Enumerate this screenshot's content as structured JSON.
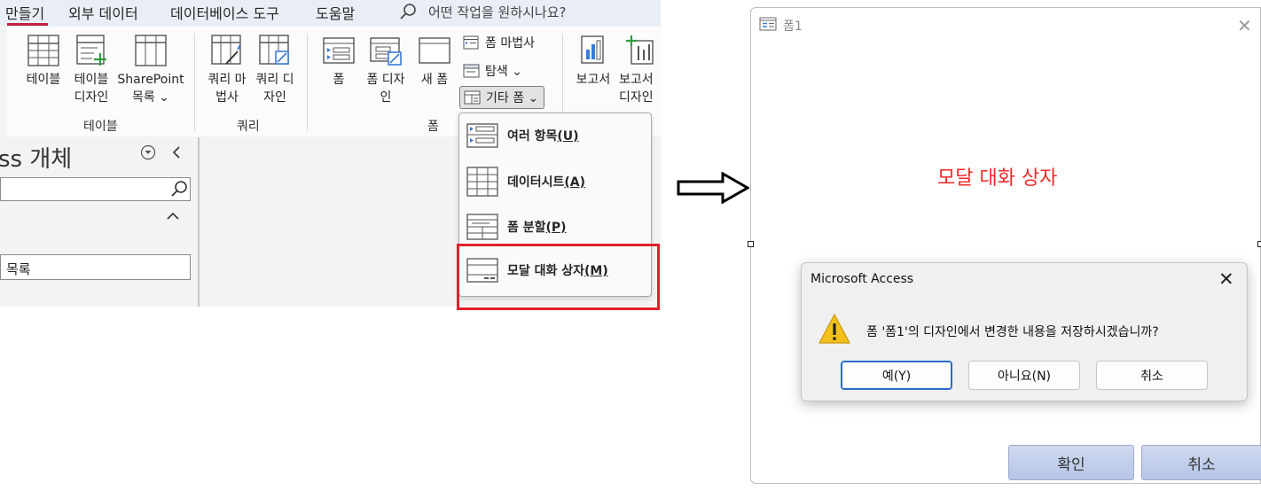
{
  "ribbon": {
    "tabs": [
      "만들기",
      "외부 데이터",
      "데이터베이스 도구",
      "도움말"
    ],
    "tell_me_placeholder": "어떤 작업을 원하시나요?",
    "groups": {
      "table": {
        "label": "테이블",
        "buttons": [
          "테이블",
          "테이블 디자인",
          "SharePoint 목록 ⌄"
        ]
      },
      "query": {
        "label": "쿼리",
        "buttons": [
          "쿼리 마법사",
          "쿼리 디자인"
        ]
      },
      "form": {
        "label": "폼",
        "buttons": [
          "폼",
          "폼 디자인",
          "새 폼"
        ],
        "small_buttons": [
          "폼 마법사",
          "탐색 ⌄",
          "기타 폼 ⌄"
        ]
      },
      "report": {
        "buttons": [
          "보고서",
          "보고서 디자인"
        ]
      }
    }
  },
  "nav_pane": {
    "title": "ss 개체",
    "item": "목록"
  },
  "other_forms_menu": {
    "items": [
      {
        "label": "여러 항목",
        "key": "(U)",
        "icon": "multiple-items-icon"
      },
      {
        "label": "데이터시트",
        "key": "(A)",
        "icon": "datasheet-icon"
      },
      {
        "label": "폼 분할",
        "key": "(P)",
        "icon": "split-form-icon"
      },
      {
        "label": "모달 대화 상자",
        "key": "(M)",
        "icon": "modal-dialog-icon"
      }
    ],
    "highlight_color": "#e0202a"
  },
  "form_window": {
    "title": "폼1",
    "label": "모달 대화 상자",
    "label_color": "#ee2a2a",
    "ok_label": "확인",
    "cancel_label": "취소"
  },
  "message_box": {
    "title": "Microsoft Access",
    "message": "폼 '폼1'의 디자인에서 변경한 내용을 저장하시겠습니까?",
    "yes_label": "예(Y)",
    "no_label": "아니요(N)",
    "cancel_label": "취소"
  }
}
